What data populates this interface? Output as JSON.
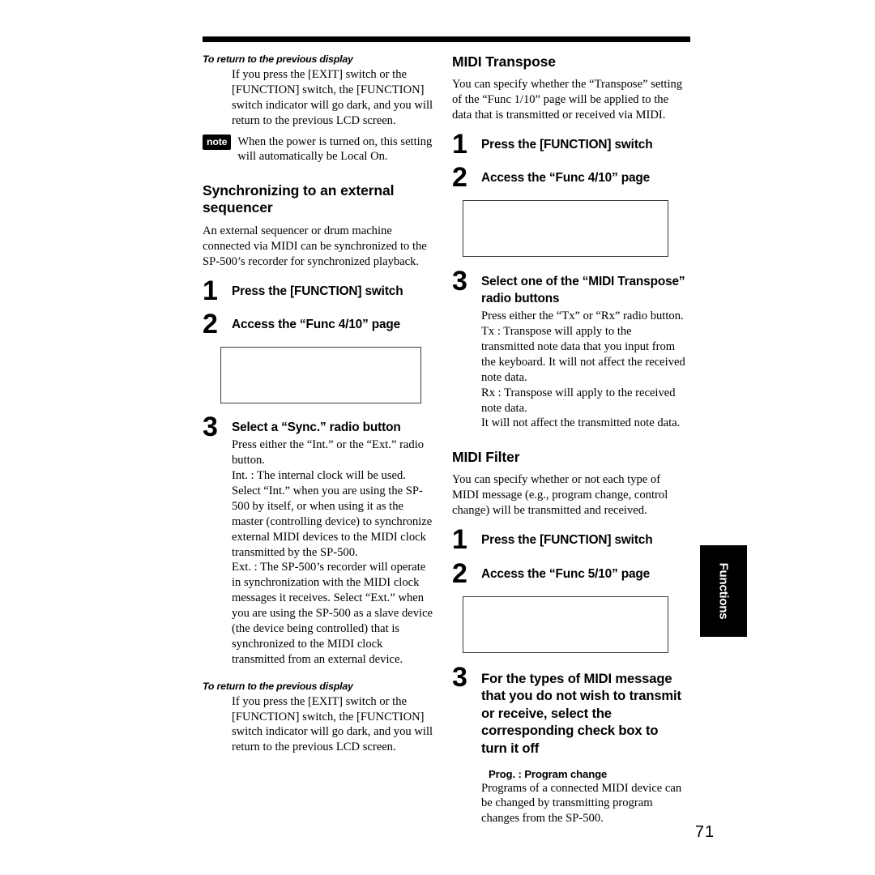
{
  "page": {
    "number": "71",
    "side_tab_label": "Functions"
  },
  "left_column": {
    "return_note": {
      "subhead": "To return to the previous display",
      "body": "If you press the [EXIT] switch or the [FUNCTION] switch, the [FUNCTION] switch indicator will go dark, and you will return to the previous LCD screen."
    },
    "note": {
      "badge": "note",
      "text": "When the power is turned on, this setting will automatically be Local On."
    },
    "sync_section": {
      "title": "Synchronizing to an external sequencer",
      "intro": "An external sequencer or drum machine connected via MIDI can be synchronized to the SP-500’s recorder for synchronized playback.",
      "steps": [
        {
          "number": "1",
          "title": "Press the [FUNCTION] switch"
        },
        {
          "number": "2",
          "title": "Access the “Func 4/10” page"
        },
        {
          "number": "3",
          "title": "Select a “Sync.” radio button",
          "detail_intro": "Press either the “Int.” or the “Ext.” radio button.",
          "definitions": [
            "Int. : The internal clock will be used. Select “Int.” when you are using the SP-500 by itself, or when using it as the master (controlling device) to synchronize external MIDI devices to the MIDI clock transmitted by the SP-500.",
            "Ext. : The SP-500’s recorder will operate in synchronization with the MIDI clock messages it receives. Select “Ext.” when you are using the SP-500 as a slave device (the device being controlled) that is synchronized to the MIDI clock transmitted from an external device."
          ]
        }
      ]
    },
    "return_note_2": {
      "subhead": "To return to the previous display",
      "body": "If you press the [EXIT] switch or the [FUNCTION] switch, the [FUNCTION] switch indicator will go dark, and you will return to the previous LCD screen."
    }
  },
  "right_column": {
    "midi_transpose": {
      "title": "MIDI Transpose",
      "intro": "You can specify whether the “Transpose” setting of the “Func 1/10” page will be applied to the data that is transmitted or received via MIDI.",
      "steps": [
        {
          "number": "1",
          "title": "Press the [FUNCTION] switch"
        },
        {
          "number": "2",
          "title": "Access the “Func 4/10” page"
        },
        {
          "number": "3",
          "title": "Select one of the “MIDI Transpose” radio buttons",
          "detail_intro": "Press either the “Tx” or “Rx” radio button.",
          "definitions": [
            "Tx : Transpose will apply to the transmitted note data that you input from the keyboard. It will not affect the received note data.",
            "Rx : Transpose will apply to the received note data.",
            "It will not affect the transmitted note data."
          ]
        }
      ]
    },
    "midi_filter": {
      "title": "MIDI Filter",
      "intro": "You can specify whether or not each type of MIDI message (e.g., program change, control change) will be transmitted and received.",
      "steps": [
        {
          "number": "1",
          "title": "Press the [FUNCTION] switch"
        },
        {
          "number": "2",
          "title": "Access the “Func 5/10” page"
        },
        {
          "number": "3",
          "title": "For the types of MIDI message that you do not wish to transmit or receive, select the corresponding check box to turn it off",
          "sub_head": "Prog. : Program change",
          "sub_body": "Programs of a connected MIDI device can be changed by transmitting program changes from the SP-500."
        }
      ]
    }
  }
}
